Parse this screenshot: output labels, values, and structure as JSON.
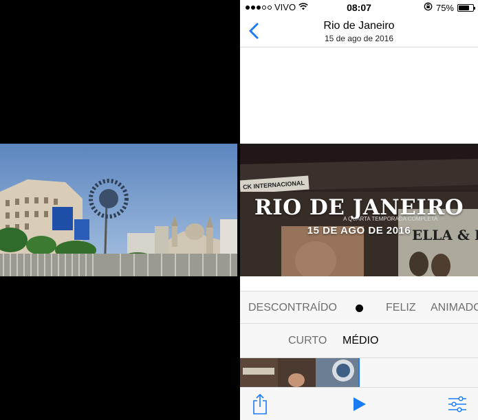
{
  "status": {
    "carrier": "VIVO",
    "time": "08:07",
    "battery": "75%",
    "battery_level": 0.75,
    "signal_bars": 3,
    "signal_total": 5
  },
  "nav": {
    "title": "Rio de Janeiro",
    "subtitle": "15 de ago de 2016"
  },
  "preview": {
    "title": "RIO DE JANEIRO",
    "date": "15 DE AGO DE 2016",
    "bg_sign": "CK INTERNACIONAL",
    "bg_sign2": "A QUARTA TEMPORADA COMPLETA",
    "bg_album": "ELLA & LOUIS"
  },
  "moods": [
    "DESCONTRAÍDO",
    "FELIZ",
    "ANIMADO"
  ],
  "lengths": {
    "short": "CURTO",
    "medium": "MÉDIO",
    "selected": "MÉDIO"
  },
  "colors": {
    "accent": "#1a7cf5",
    "toolbar_bg": "#f7f7f7"
  },
  "icons": {
    "back": "chevron-left-icon",
    "share": "share-icon",
    "play": "play-icon",
    "adjust": "sliders-icon",
    "wifi": "wifi-icon",
    "lock": "rotation-lock-icon",
    "battery": "battery-icon"
  }
}
